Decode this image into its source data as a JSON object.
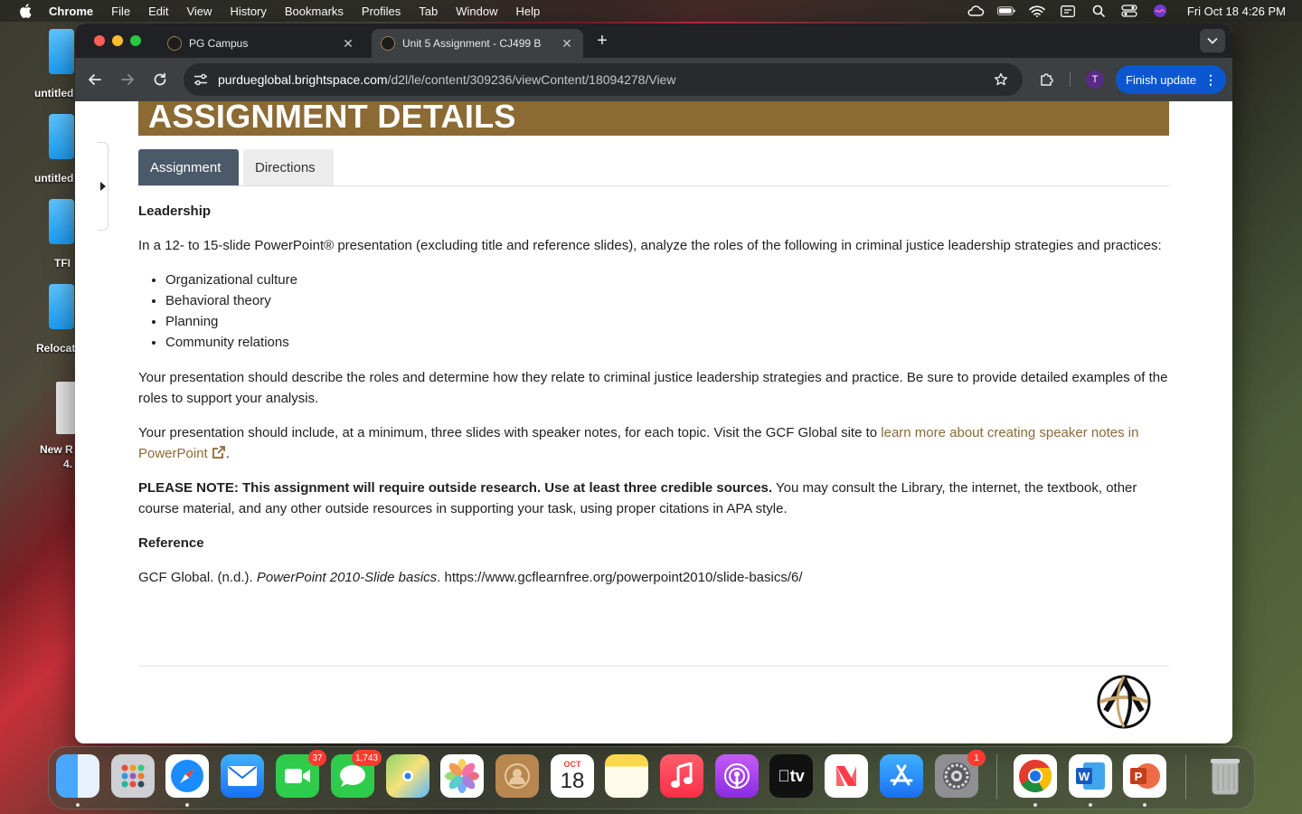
{
  "menubar": {
    "app_name": "Chrome",
    "items": [
      "File",
      "Edit",
      "View",
      "History",
      "Bookmarks",
      "Profiles",
      "Tab",
      "Window",
      "Help"
    ],
    "clock": "Fri Oct 18  4:26 PM"
  },
  "desktop": {
    "icons": [
      "untitled",
      "untitled",
      "TFI",
      "Relocat",
      "New R",
      "4."
    ]
  },
  "browser": {
    "tabs": [
      {
        "title": "PG Campus"
      },
      {
        "title": "Unit 5 Assignment - CJ499 B"
      }
    ],
    "url_host": "purdueglobal.brightspace.com",
    "url_path": "/d2l/le/content/309236/viewContent/18094278/View",
    "profile_initial": "T",
    "finish_update_label": "Finish update"
  },
  "page": {
    "banner_title": "ASSIGNMENT DETAILS",
    "tabs": {
      "assignment": "Assignment",
      "directions": "Directions"
    },
    "heading": "Leadership",
    "intro": "In a 12- to 15-slide PowerPoint® presentation (excluding title and reference slides), analyze the roles of the following in criminal justice leadership strategies and practices:",
    "topics": [
      "Organizational culture",
      "Behavioral theory",
      "Planning",
      "Community relations"
    ],
    "para2": "Your presentation should describe the roles and determine how they relate to criminal justice leadership strategies and practice. Be sure to provide detailed examples of the roles to support your analysis.",
    "para3_before": "Your presentation should include, at a minimum, three slides with speaker notes, for each topic. Visit the GCF Global site to ",
    "para3_link": "learn more about creating speaker notes in PowerPoint",
    "para3_after": ".",
    "note_bold": "PLEASE NOTE: This assignment will require outside research. Use at least three credible sources.",
    "note_rest": " You may consult the Library, the internet, the textbook, other course material, and any other outside resources in supporting your task, using proper citations in APA style.",
    "reference_heading": "Reference",
    "reference_author": "GCF Global. (n.d.). ",
    "reference_title": "PowerPoint 2010-Slide basics",
    "reference_url": ". https://www.gcflearnfree.org/powerpoint2010/slide-basics/6/"
  },
  "dock": {
    "badges": {
      "facetime": "37",
      "messages": "1,743",
      "settings": "1"
    },
    "calendar_month": "OCT",
    "calendar_day": "18",
    "tv_label": "tv"
  },
  "colors": {
    "banner": "#8b6a34",
    "active_tab": "#4b5a69",
    "link": "#8b6a34",
    "chrome_update": "#0b57d0"
  }
}
